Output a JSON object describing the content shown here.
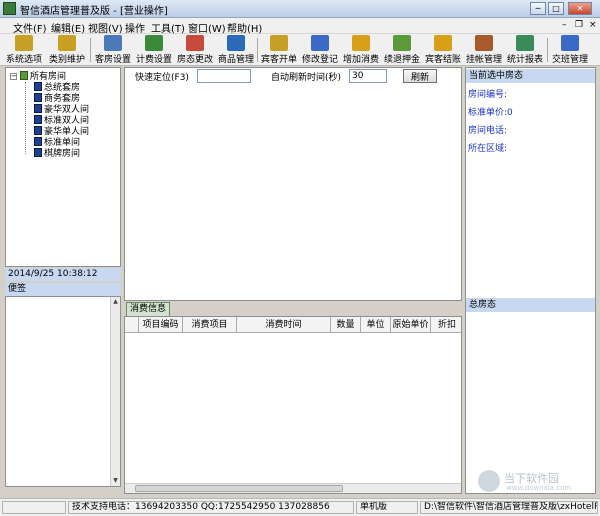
{
  "window": {
    "title": "智信酒店管理普及版 - [营业操作]",
    "min": "─",
    "max": "□",
    "close": "✕"
  },
  "menu": [
    {
      "label": "文件(F)"
    },
    {
      "label": "编辑(E)"
    },
    {
      "label": "视图(V)"
    },
    {
      "label": "操作"
    },
    {
      "label": "工具(T)"
    },
    {
      "label": "窗口(W)"
    },
    {
      "label": "帮助(H)"
    }
  ],
  "mdi": {
    "min": "–",
    "restore": "❐",
    "close": "×"
  },
  "toolbar": [
    {
      "label": "系统选项",
      "icon": "key-icon",
      "color": "#c8a024"
    },
    {
      "label": "类别维护",
      "icon": "key-icon",
      "color": "#c8a024"
    },
    {
      "label": "客房设置",
      "icon": "room-icon",
      "color": "#4a7ab8"
    },
    {
      "label": "计费设置",
      "icon": "money-icon",
      "color": "#3a8a3a"
    },
    {
      "label": "房态更改",
      "icon": "room-state-icon",
      "color": "#c84a3a"
    },
    {
      "label": "商品管理",
      "icon": "goods-icon",
      "color": "#2a6ab8"
    },
    {
      "label": "宾客开单",
      "icon": "open-bill-icon",
      "color": "#c8a024"
    },
    {
      "label": "修改登记",
      "icon": "edit-register-icon",
      "color": "#3a6ac8"
    },
    {
      "label": "增加消费",
      "icon": "add-consume-icon",
      "color": "#d8a018"
    },
    {
      "label": "续退押金",
      "icon": "deposit-icon",
      "color": "#5a9a3a"
    },
    {
      "label": "宾客结账",
      "icon": "checkout-icon",
      "color": "#d8a018"
    },
    {
      "label": "挂帐管理",
      "icon": "credit-icon",
      "color": "#a85a2a"
    },
    {
      "label": "统计报表",
      "icon": "report-icon",
      "color": "#3a8a5a"
    },
    {
      "label": "交班管理",
      "icon": "shift-icon",
      "color": "#3a6ac8"
    }
  ],
  "tree": {
    "root": "所有房间",
    "children": [
      "总统套房",
      "商务套房",
      "豪华双人间",
      "标准双人间",
      "豪华单人间",
      "标准单间",
      "棋牌房间"
    ]
  },
  "datetime": "2014/9/25  10:38:12",
  "memo": {
    "title": "便签"
  },
  "center": {
    "locate_label": "快速定位(F3)",
    "locate_value": "",
    "refresh_label": "自动刷新时间(秒)",
    "refresh_value": "30",
    "refresh_button": "刷新"
  },
  "consume": {
    "tab": "消费信息",
    "columns": [
      "项目编码",
      "消费项目",
      "消费时间",
      "数量",
      "单位",
      "原始单价",
      "折扣"
    ]
  },
  "right": {
    "current_title": "当前选中房态",
    "fields": [
      "房间编号:",
      "标准单价:0",
      "房间电话:",
      "所在区域:"
    ],
    "total_title": "总房态"
  },
  "status": {
    "support": "技术支持电话：13694203350 QQ:1725542950 137028856",
    "edition": "单机版",
    "path": "D:\\智信软件\\智信酒店管理普及版\\zxHotelPJD"
  },
  "watermark": {
    "text": "当下软件园",
    "sub": "www.downxia.com"
  }
}
